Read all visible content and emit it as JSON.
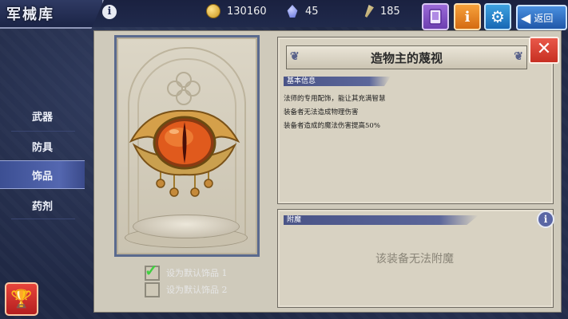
{
  "header": {
    "title": "军械库",
    "info_icon": "info-icon",
    "resources": [
      {
        "icon": "gold-coin-icon",
        "value": "130160"
      },
      {
        "icon": "blue-gem-icon",
        "value": "45"
      },
      {
        "icon": "feather-icon",
        "value": "185"
      }
    ],
    "buttons": {
      "book_icon": "book-icon",
      "info_icon": "info-icon",
      "gear_icon": "gear-icon",
      "back_label": "返回"
    }
  },
  "sidebar": {
    "items": [
      {
        "label": "武器",
        "active": false
      },
      {
        "label": "防具",
        "active": false
      },
      {
        "label": "饰品",
        "active": true
      },
      {
        "label": "药剂",
        "active": false
      }
    ],
    "trophy_icon": "trophy-icon"
  },
  "item": {
    "name": "造物主的蔑视",
    "icon": "eye-amulet-icon",
    "basic_info_label": "基本信息",
    "description_lines": [
      "法师的专用配饰，能让其充满智慧",
      "装备者无法造成物理伤害",
      "装备者造成的魔法伤害提高50%"
    ],
    "close_icon": "close-icon"
  },
  "defaults": [
    {
      "label": "设为默认饰品 1",
      "checked": true
    },
    {
      "label": "设为默认饰品 2",
      "checked": false
    }
  ],
  "enchant": {
    "label": "附魔",
    "message": "该装备无法附魔",
    "info_icon": "info-icon"
  },
  "colors": {
    "background": "#202945",
    "panel": "#cfcabb",
    "active_tab": "#5467b0",
    "close": "#d8412f",
    "gear_button": "#1f7ac8",
    "info_button": "#e8841f",
    "book_button": "#8657c6"
  }
}
